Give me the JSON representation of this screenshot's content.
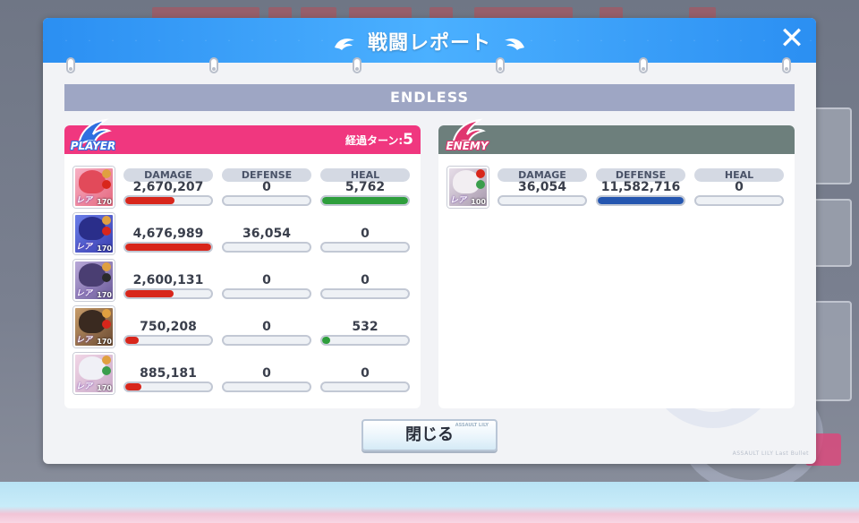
{
  "dialog": {
    "title": "戦闘レポート",
    "close_icon": "close-x-icon",
    "mode": "ENDLESS",
    "close_button_label": "閉じる",
    "close_button_deco": "ASSAULT LILY",
    "footer_logo": "ASSAULT LILY Last Bullet"
  },
  "colors": {
    "header_blue": "#2b8ff2",
    "player_pink": "#f0377f",
    "enemy_gray": "#6d7f7c",
    "damage_red": "#d8261b",
    "defense_blue": "#2456b0",
    "heal_green": "#2e9e3c"
  },
  "labels": {
    "damage": "DAMAGE",
    "defense": "DEFENSE",
    "heal": "HEAL"
  },
  "player": {
    "badge": "PLAYER",
    "turn_label": "経過ターン:",
    "turn_value": "5",
    "rows": [
      {
        "damage": "2,670,207",
        "defense": "0",
        "heal": "5,762",
        "damage_fill": 0.57,
        "defense_fill": 0,
        "heal_fill": 1.0,
        "level": "170",
        "rank": "レア"
      },
      {
        "damage": "4,676,989",
        "defense": "36,054",
        "heal": "0",
        "damage_fill": 1.0,
        "defense_fill": 0,
        "heal_fill": 0,
        "level": "170",
        "rank": "レア"
      },
      {
        "damage": "2,600,131",
        "defense": "0",
        "heal": "0",
        "damage_fill": 0.56,
        "defense_fill": 0,
        "heal_fill": 0,
        "level": "170",
        "rank": "レア"
      },
      {
        "damage": "750,208",
        "defense": "0",
        "heal": "532",
        "damage_fill": 0.16,
        "defense_fill": 0,
        "heal_fill": 0.09,
        "level": "170",
        "rank": "レア"
      },
      {
        "damage": "885,181",
        "defense": "0",
        "heal": "0",
        "damage_fill": 0.19,
        "defense_fill": 0,
        "heal_fill": 0,
        "level": "170",
        "rank": "レア"
      }
    ]
  },
  "enemy": {
    "badge": "ENEMY",
    "rows": [
      {
        "damage": "36,054",
        "defense": "11,582,716",
        "heal": "0",
        "damage_fill": 0,
        "defense_fill": 1.0,
        "heal_fill": 0,
        "level": "100",
        "rank": "レア"
      }
    ]
  }
}
